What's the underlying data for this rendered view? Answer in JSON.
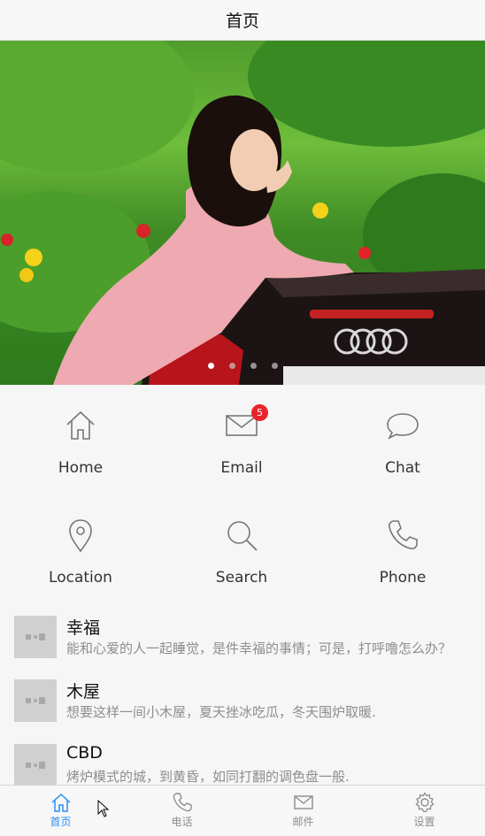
{
  "header": {
    "title": "首页"
  },
  "banner": {
    "dots": 4,
    "active_dot": 0
  },
  "grid": {
    "items": [
      {
        "label": "Home",
        "icon": "home-icon"
      },
      {
        "label": "Email",
        "icon": "mail-icon",
        "badge": "5"
      },
      {
        "label": "Chat",
        "icon": "chat-icon"
      },
      {
        "label": "Location",
        "icon": "location-pin-icon"
      },
      {
        "label": "Search",
        "icon": "search-icon"
      },
      {
        "label": "Phone",
        "icon": "phone-icon"
      }
    ]
  },
  "list": {
    "items": [
      {
        "title": "幸福",
        "desc": "能和心爱的人一起睡觉，是件幸福的事情；可是，打呼噜怎么办？"
      },
      {
        "title": "木屋",
        "desc": "想要这样一间小木屋，夏天挫冰吃瓜，冬天围炉取暖."
      },
      {
        "title": "CBD",
        "desc": "烤炉模式的城，到黄昏，如同打翻的调色盘一般."
      }
    ]
  },
  "tabbar": {
    "items": [
      {
        "label": "首页",
        "icon": "home-icon",
        "active": true
      },
      {
        "label": "电话",
        "icon": "phone-icon",
        "active": false
      },
      {
        "label": "邮件",
        "icon": "mail-icon",
        "active": false
      },
      {
        "label": "设置",
        "icon": "gear-icon",
        "active": false
      }
    ]
  },
  "colors": {
    "accent": "#2a8ff5",
    "badge": "#e8242b"
  }
}
